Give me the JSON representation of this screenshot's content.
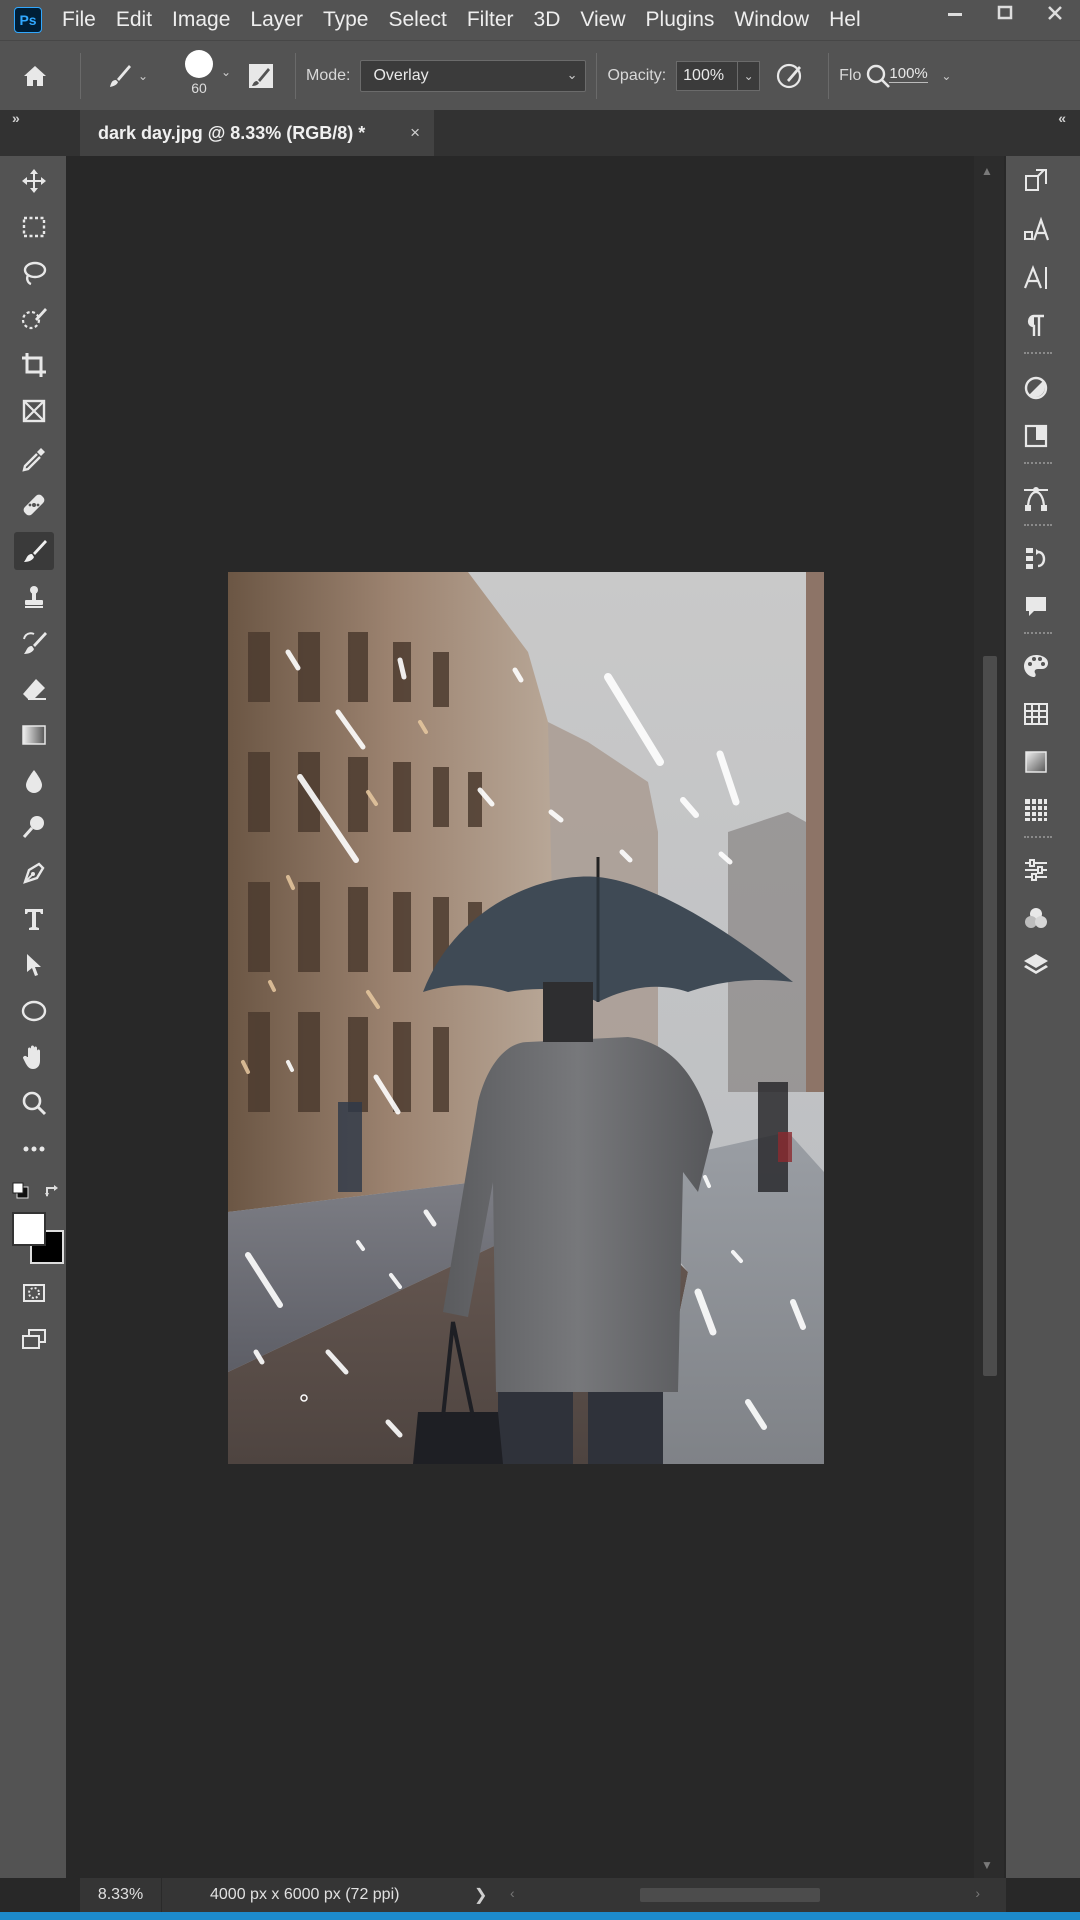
{
  "app": {
    "logo_text": "Ps"
  },
  "menu": [
    "File",
    "Edit",
    "Image",
    "Layer",
    "Type",
    "Select",
    "Filter",
    "3D",
    "View",
    "Plugins",
    "Window",
    "Hel"
  ],
  "options": {
    "brush_size": "60",
    "mode_label": "Mode:",
    "mode_value": "Overlay",
    "opacity_label": "Opacity:",
    "opacity_value": "100%",
    "flow_label": "Flo",
    "flow_value": "100%"
  },
  "document_tab": {
    "title": "dark day.jpg @ 8.33% (RGB/8) *",
    "close": "×"
  },
  "status": {
    "zoom": "8.33%",
    "doc_info": "4000 px x 6000 px (72 ppi)"
  },
  "colors": {
    "foreground": "#ffffff",
    "background": "#000000",
    "accent": "#31a8ff",
    "active_tool_bg": "#3a3a3a"
  },
  "tools": [
    "move-icon",
    "marquee-icon",
    "lasso-icon",
    "quick-select-icon",
    "crop-icon",
    "frame-icon",
    "eyedropper-icon",
    "healing-icon",
    "brush-icon",
    "stamp-icon",
    "history-brush-icon",
    "eraser-icon",
    "gradient-icon",
    "blur-icon",
    "dodge-icon",
    "pen-icon",
    "type-icon",
    "path-select-icon",
    "ellipse-icon",
    "hand-icon",
    "zoom-icon",
    "more-icon"
  ]
}
